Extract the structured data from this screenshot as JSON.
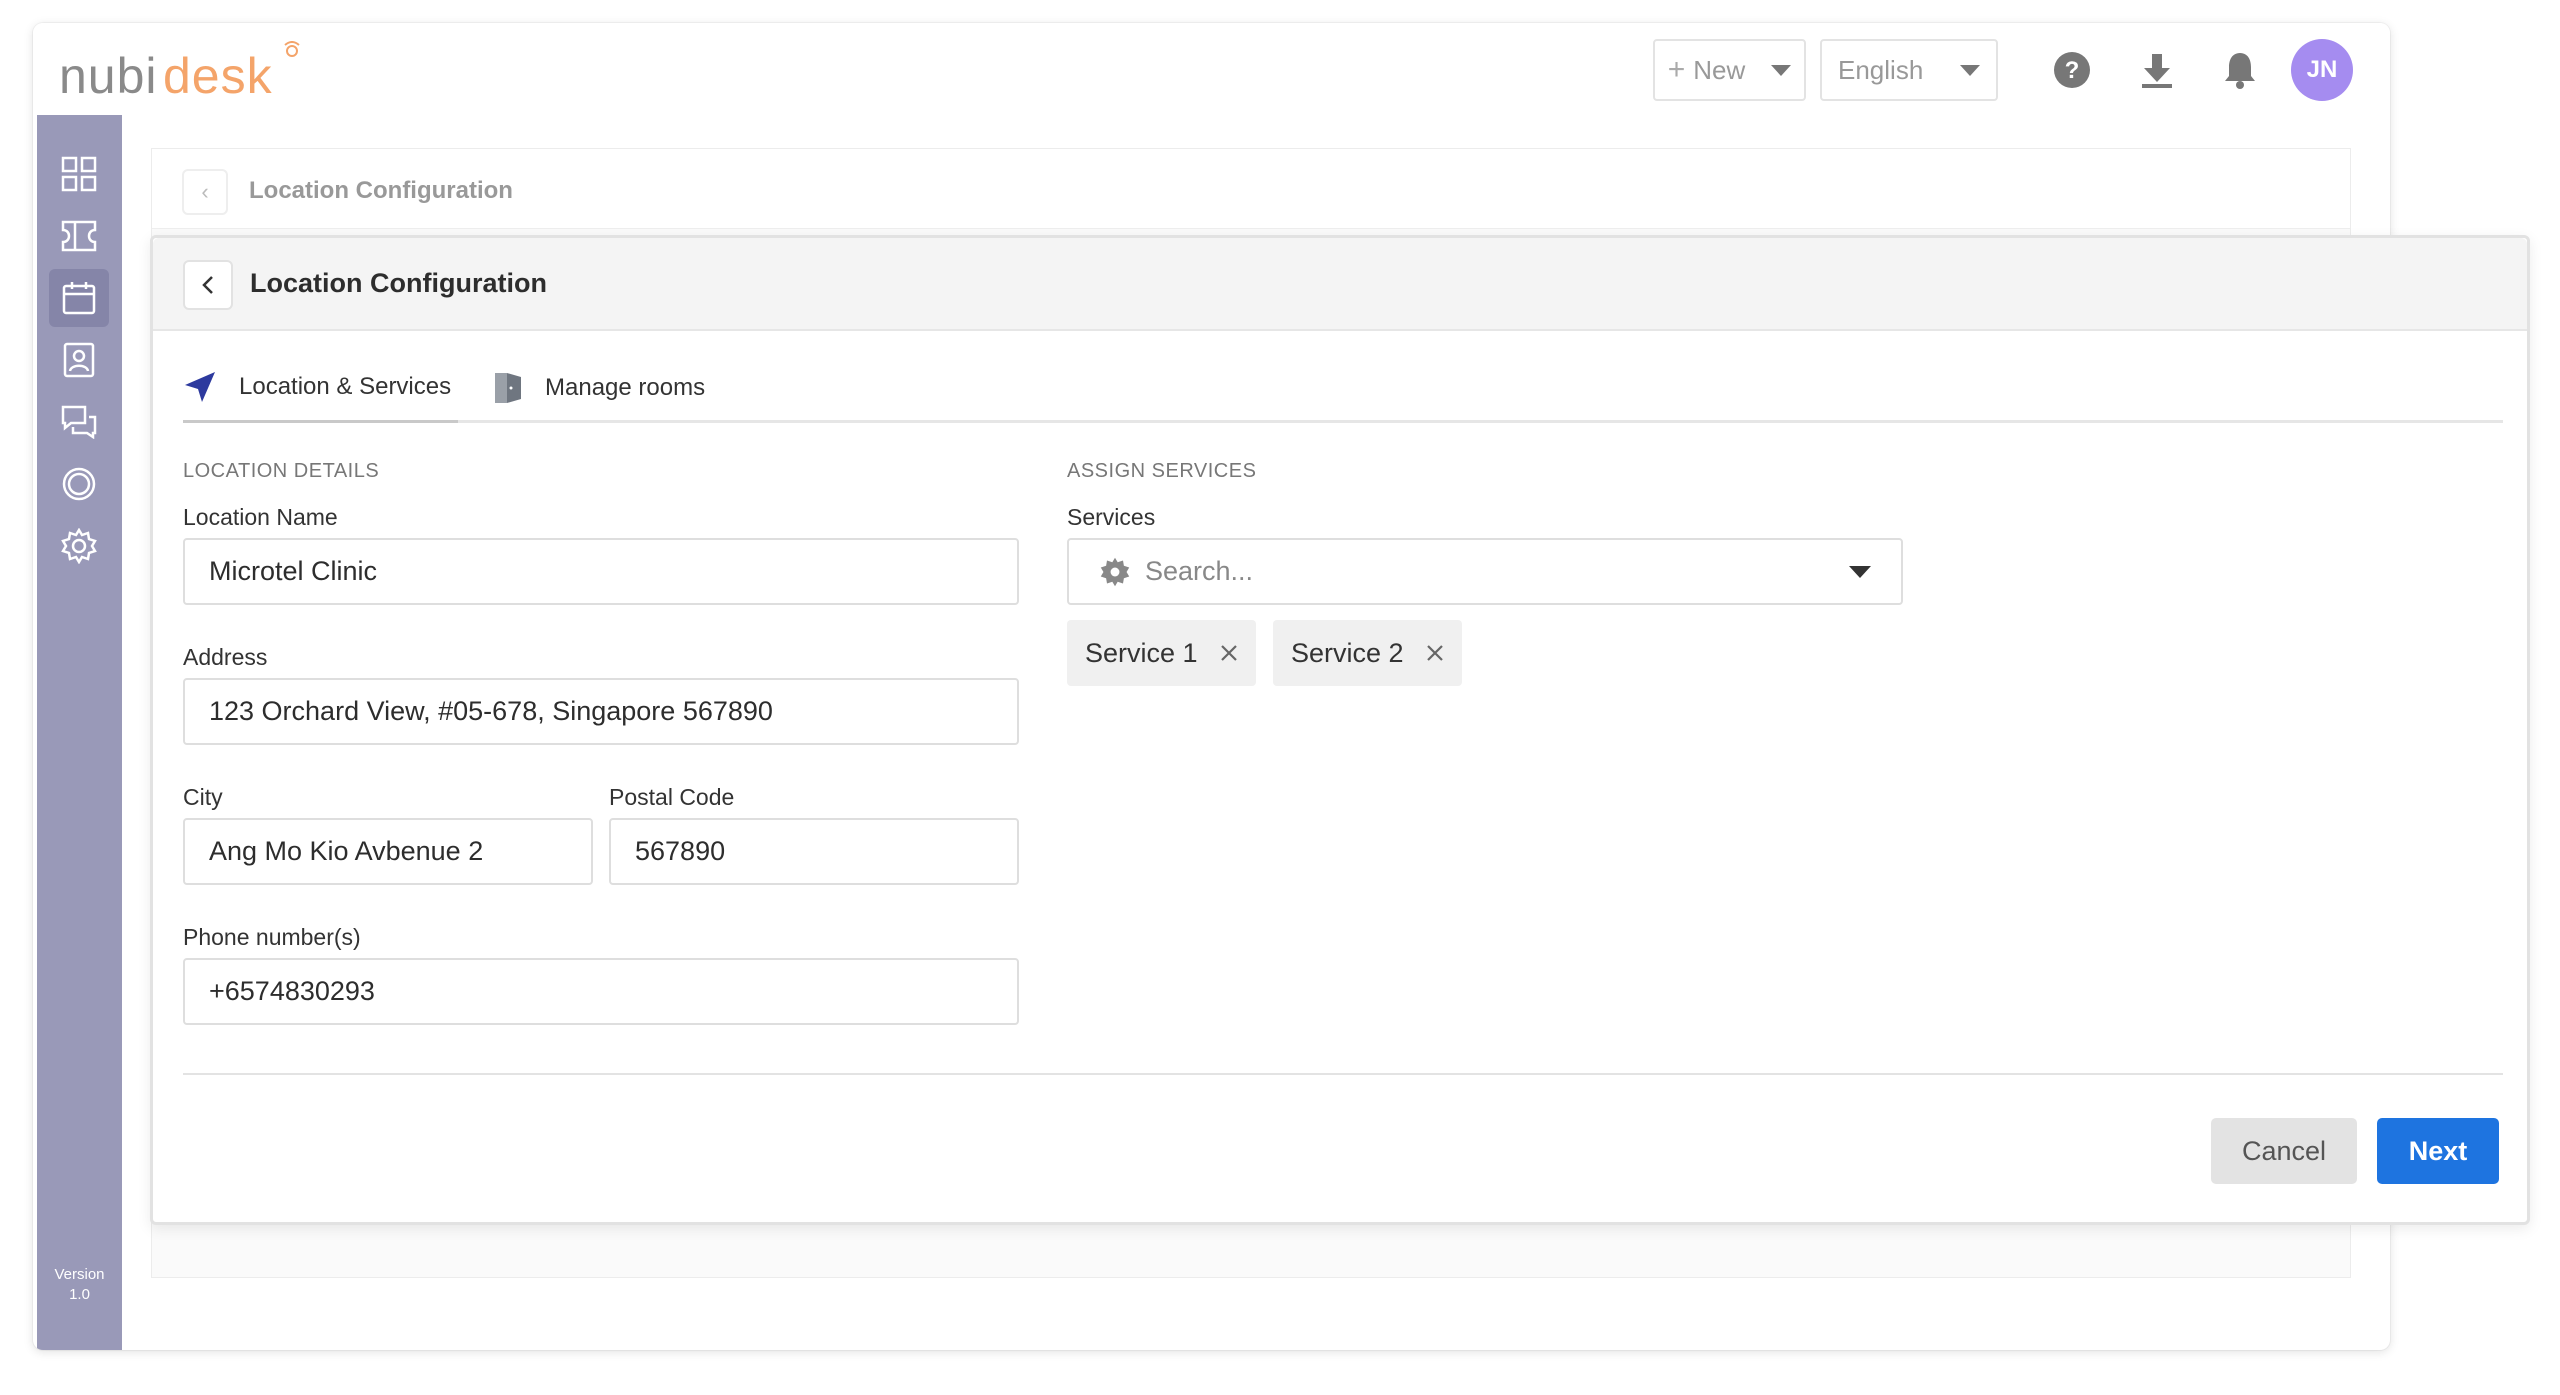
{
  "app": {
    "logo_text": "nubidesk"
  },
  "topbar": {
    "new_label": "New",
    "language": "English",
    "avatar_initials": "JN"
  },
  "sidebar": {
    "items": [
      {
        "icon": "dashboard-grid-icon"
      },
      {
        "icon": "ticket-icon"
      },
      {
        "icon": "calendar-icon",
        "active": true
      },
      {
        "icon": "contact-card-icon"
      },
      {
        "icon": "chat-bubbles-icon"
      },
      {
        "icon": "circle-icon"
      },
      {
        "icon": "gear-icon"
      }
    ],
    "version_label": "Version",
    "version_number": "1.0"
  },
  "background_panel": {
    "title": "Location Configuration"
  },
  "modal": {
    "title": "Location Configuration",
    "tabs": [
      {
        "label": "Location & Services",
        "icon": "navigation-arrow-icon",
        "active": true
      },
      {
        "label": "Manage rooms",
        "icon": "door-icon",
        "active": false
      }
    ],
    "location_details": {
      "section_label": "LOCATION DETAILS",
      "name_label": "Location Name",
      "name_value": "Microtel Clinic",
      "address_label": "Address",
      "address_value": "123 Orchard View, #05-678, Singapore 567890",
      "city_label": "City",
      "city_value": "Ang Mo Kio Avbenue 2",
      "postal_label": "Postal Code",
      "postal_value": "567890",
      "phone_label": "Phone number(s)",
      "phone_value": "+6574830293"
    },
    "assign_services": {
      "section_label": "ASSIGN SERVICES",
      "services_label": "Services",
      "search_placeholder": "Search...",
      "selected": [
        "Service 1",
        "Service 2"
      ]
    },
    "actions": {
      "cancel_label": "Cancel",
      "next_label": "Next"
    }
  },
  "colors": {
    "sidebar": "#9999b8",
    "primary": "#1e74e0",
    "avatar": "#a58cf0",
    "tab_icon": "#2d3a9e",
    "logo_accent": "#f4a46a"
  }
}
